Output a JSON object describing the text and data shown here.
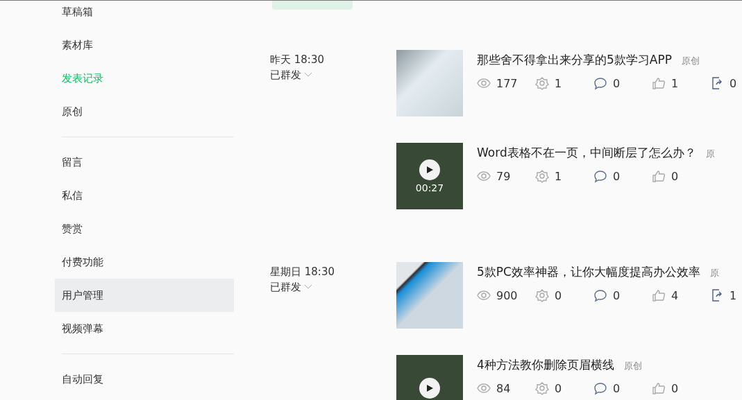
{
  "sidebar": {
    "items": [
      {
        "kind": "link",
        "label": "草稿箱",
        "selected": false,
        "hovered": false
      },
      {
        "kind": "link",
        "label": "素材库",
        "selected": false,
        "hovered": false
      },
      {
        "kind": "link",
        "label": "发表记录",
        "selected": true,
        "hovered": false
      },
      {
        "kind": "link",
        "label": "原创",
        "selected": false,
        "hovered": false
      },
      {
        "kind": "divider"
      },
      {
        "kind": "link",
        "label": "留言",
        "selected": false,
        "hovered": false
      },
      {
        "kind": "link",
        "label": "私信",
        "selected": false,
        "hovered": false
      },
      {
        "kind": "link",
        "label": "赞赏",
        "selected": false,
        "hovered": false
      },
      {
        "kind": "link",
        "label": "付费功能",
        "selected": false,
        "hovered": false
      },
      {
        "kind": "link",
        "label": "用户管理",
        "selected": false,
        "hovered": true
      },
      {
        "kind": "link",
        "label": "视频弹幕",
        "selected": false,
        "hovered": false
      },
      {
        "kind": "divider"
      },
      {
        "kind": "link",
        "label": "自动回复",
        "selected": false,
        "hovered": false
      }
    ]
  },
  "posts": [
    {
      "time": "昨天 18:30",
      "status": "已群发",
      "articles": [
        {
          "kind": "book",
          "title": "那些舍不得拿出来分享的5款学习APP",
          "tag": "原创",
          "stats": [
            {
              "kind": "views",
              "value": "177"
            },
            {
              "kind": "shares",
              "value": "1"
            },
            {
              "kind": "comments",
              "value": "0"
            },
            {
              "kind": "likes",
              "value": "1"
            },
            {
              "kind": "forwards",
              "value": "0"
            }
          ]
        },
        {
          "kind": "video",
          "title": "Word表格不在一页，中间断层了怎么办？",
          "tag": "原",
          "duration": "00:27",
          "stats": [
            {
              "kind": "views",
              "value": "79"
            },
            {
              "kind": "shares",
              "value": "1"
            },
            {
              "kind": "comments",
              "value": "0"
            },
            {
              "kind": "likes",
              "value": "0"
            }
          ]
        }
      ]
    },
    {
      "time": "星期日 18:30",
      "status": "已群发",
      "articles": [
        {
          "kind": "screen",
          "title": "5款PC效率神器，让你大幅度提高办公效率",
          "tag": "原",
          "stats": [
            {
              "kind": "views",
              "value": "900"
            },
            {
              "kind": "shares",
              "value": "0"
            },
            {
              "kind": "comments",
              "value": "0"
            },
            {
              "kind": "likes",
              "value": "4"
            },
            {
              "kind": "forwards",
              "value": "1"
            }
          ]
        },
        {
          "kind": "video",
          "title": "4种方法教你删除页眉横线",
          "tag": "原创",
          "stats": [
            {
              "kind": "views",
              "value": "84"
            },
            {
              "kind": "shares",
              "value": "0"
            },
            {
              "kind": "comments",
              "value": "0"
            },
            {
              "kind": "likes",
              "value": "0"
            }
          ]
        }
      ]
    }
  ]
}
